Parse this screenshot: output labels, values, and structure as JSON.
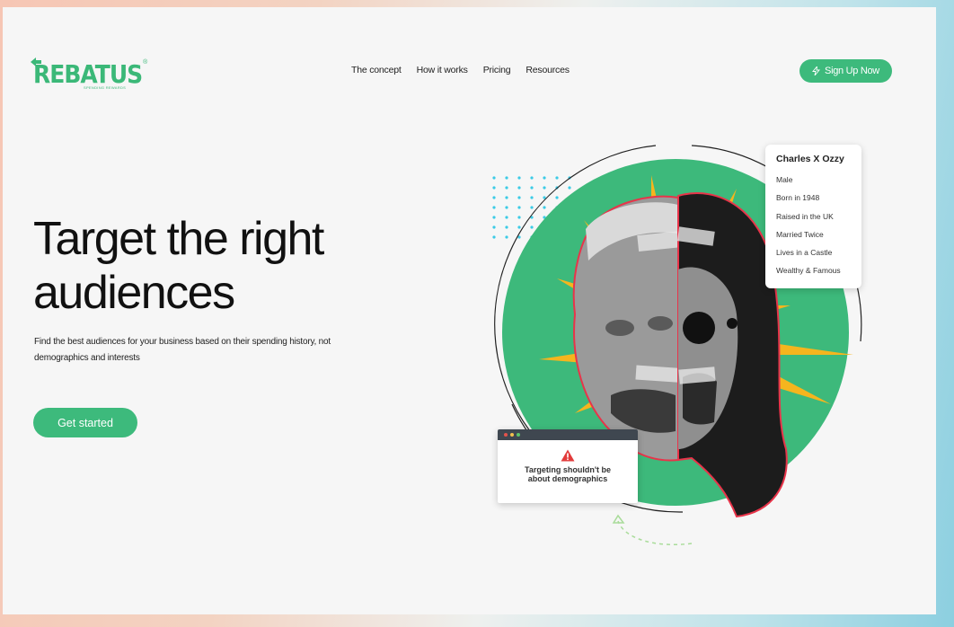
{
  "brand": {
    "name": "REBATUS",
    "registered": "®",
    "tagline": "SPENDING REWARDS",
    "color": "#3bb878"
  },
  "nav": {
    "items": [
      "The concept",
      "How it works",
      "Pricing",
      "Resources"
    ]
  },
  "header": {
    "signup_label": "Sign Up Now",
    "signup_icon": "lightning-icon"
  },
  "hero": {
    "headline_line1": "Target the right",
    "headline_line2": "audiences",
    "subtext": "Find the best audiences for your business based on their spending history, not demographics and interests",
    "cta_label": "Get started"
  },
  "profile_card": {
    "title": "Charles X Ozzy",
    "items": [
      "Male",
      "Born in 1948",
      "Raised in the UK",
      "Married Twice",
      "Lives in a Castle",
      "Wealthy & Famous"
    ]
  },
  "alert": {
    "icon": "warning-icon",
    "text_line1": "Targeting shouldn't be",
    "text_line2": "about demographics",
    "window_dots": [
      "#e5534b",
      "#f2c14e",
      "#5bc46a"
    ]
  },
  "colors": {
    "accent": "#3dba7c",
    "circle": "#3db97b",
    "burst": "#f5b51e",
    "dots": "#3ccbe6",
    "warning": "#e23b3b"
  }
}
